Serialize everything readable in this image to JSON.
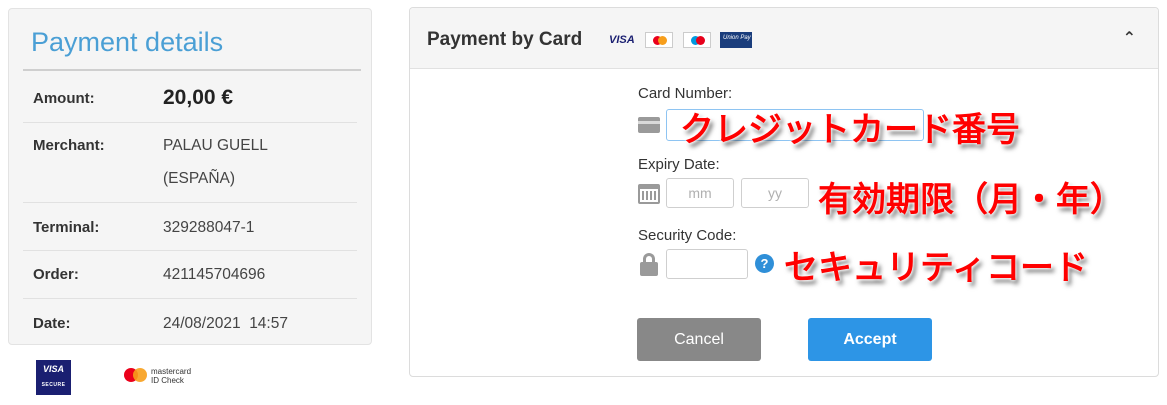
{
  "details": {
    "title": "Payment details",
    "rows": [
      {
        "label": "Amount:",
        "value": "20,00 €"
      },
      {
        "label": "Merchant:",
        "value_line1": "PALAU GUELL",
        "value_line2": "(ESPAÑA)"
      },
      {
        "label": "Terminal:",
        "value": "329288047-1"
      },
      {
        "label": "Order:",
        "value": "421145704696"
      },
      {
        "label": "Date:",
        "value": "24/08/2021  14:57"
      }
    ]
  },
  "security_logos": {
    "visa": "VISA",
    "visa_sub": "SECURE",
    "mastercard_line1": "mastercard",
    "mastercard_line2": "ID Check"
  },
  "card_panel": {
    "title": "Payment by Card",
    "brands": {
      "visa": "VISA",
      "jcb": "Union Pay"
    },
    "card_number_label": "Card Number:",
    "expiry_label": "Expiry Date:",
    "mm_placeholder": "mm",
    "yy_placeholder": "yy",
    "security_label": "Security Code:",
    "help_glyph": "?",
    "collapse_glyph": "⌃",
    "cancel_label": "Cancel",
    "accept_label": "Accept"
  },
  "annotations": {
    "card_number": "クレジットカード番号",
    "expiry": "有効期限（月・年）",
    "security": "セキュリティコード"
  },
  "colors": {
    "accent": "#4a9fd5",
    "accept": "#2d95e6",
    "cancel": "#888888",
    "annotation": "#ff0000"
  }
}
